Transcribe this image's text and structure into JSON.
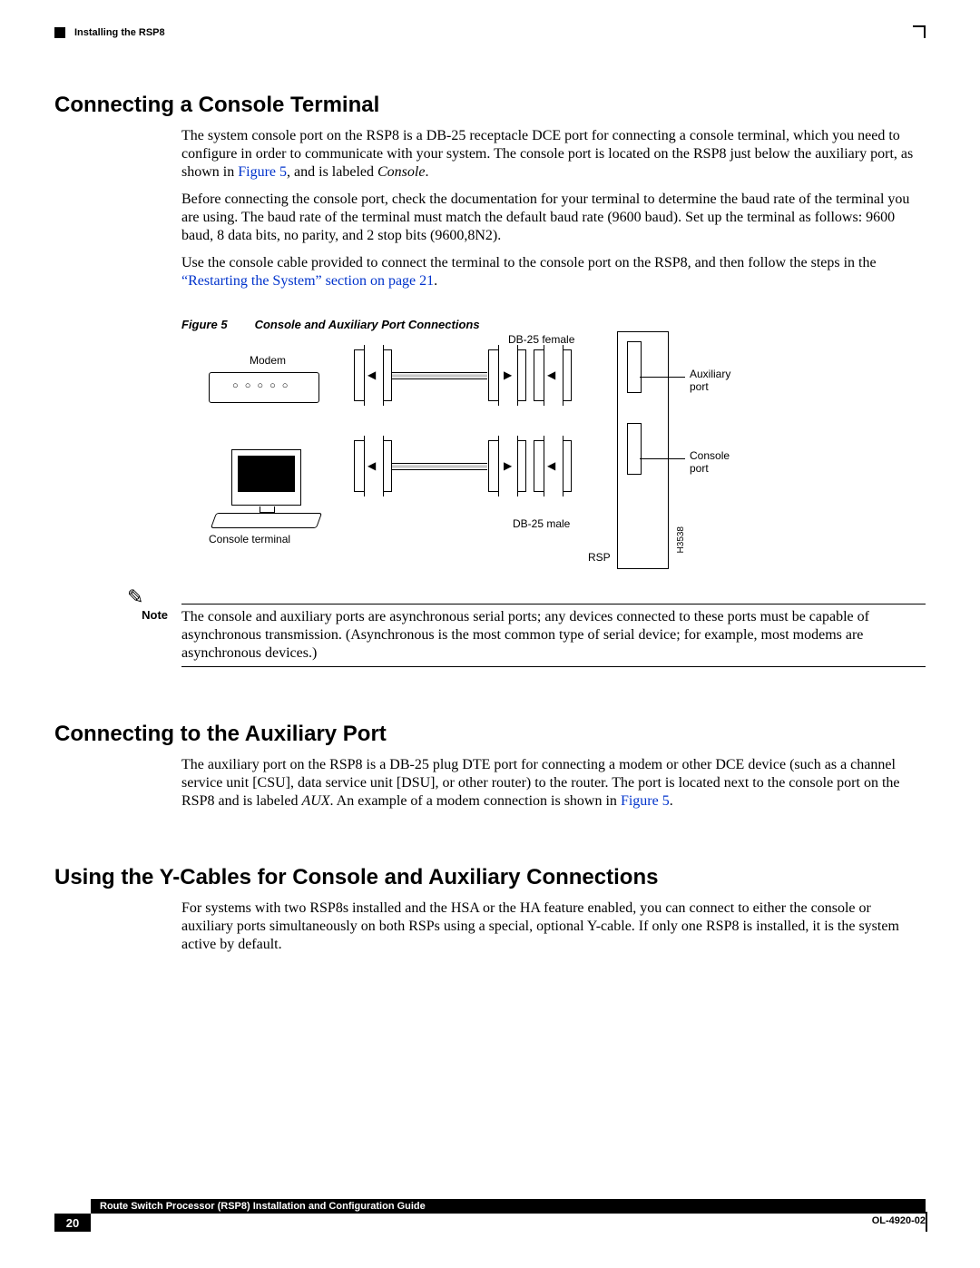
{
  "header": {
    "chapter": "Installing the RSP8"
  },
  "section1": {
    "heading": "Connecting a Console Terminal",
    "p1a": "The system console port on the RSP8 is a DB-25 receptacle DCE port for connecting a console terminal, which you need to configure in order to communicate with your system. The console port is located on the RSP8 just below the auxiliary port, as shown in ",
    "p1_link": "Figure 5",
    "p1b": ", and is labeled ",
    "p1_italic": "Console",
    "p1c": ".",
    "p2": "Before connecting the console port, check the documentation for your terminal to determine the baud rate of the terminal you are using. The baud rate of the terminal must match the default baud rate (9600 baud). Set up the terminal as follows: 9600 baud, 8 data bits, no parity, and 2 stop bits (9600,8N2).",
    "p3a": "Use the console cable provided to connect the terminal to the console port on the RSP8, and then follow the steps in the ",
    "p3_link": "“Restarting the System” section on page 21",
    "p3b": "."
  },
  "figure": {
    "caption_num": "Figure 5",
    "caption_title": "Console and Auxiliary Port Connections",
    "labels": {
      "modem": "Modem",
      "db25_female": "DB-25 female",
      "aux_port": "Auxiliary\nport",
      "console_port": "Console\nport",
      "db25_male": "DB-25 male",
      "console_terminal": "Console terminal",
      "rsp": "RSP",
      "fignum": "H3538"
    }
  },
  "note": {
    "label": "Note",
    "text": "The console and auxiliary ports are asynchronous serial ports; any devices connected to these ports must be capable of asynchronous transmission. (Asynchronous is the most common type of serial device; for example, most modems are asynchronous devices.)"
  },
  "section2": {
    "heading": "Connecting to the Auxiliary Port",
    "p1a": "The auxiliary port on the RSP8 is a DB-25 plug DTE port for connecting a modem or other DCE device (such as a channel service unit [CSU], data service unit [DSU], or other router) to the router. The port is located next to the console port on the RSP8 and is labeled ",
    "p1_italic": "AUX",
    "p1b": ". An example of a modem connection is shown in ",
    "p1_link": "Figure 5",
    "p1c": "."
  },
  "section3": {
    "heading": "Using the Y-Cables for Console and Auxiliary Connections",
    "p1": "For systems with two RSP8s installed and the HSA or the HA feature enabled, you can connect to either the console or auxiliary ports simultaneously on both RSPs using a special, optional Y-cable. If only one RSP8 is installed, it is the system active by default."
  },
  "footer": {
    "doc_title": "Route Switch Processor (RSP8) Installation and Configuration Guide",
    "page_num": "20",
    "doc_id": "OL-4920-02"
  }
}
